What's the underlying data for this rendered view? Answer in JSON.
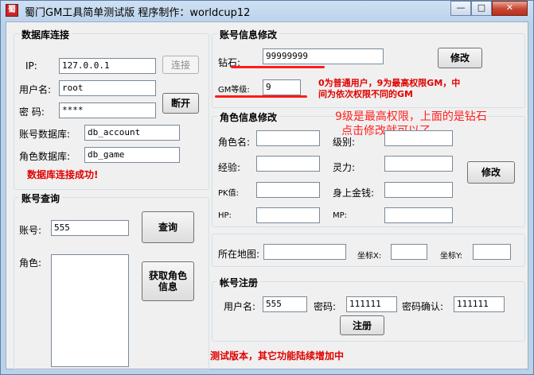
{
  "window": {
    "title": "蜀门GM工具简单测试版 程序制作：worldcup12",
    "minimize_glyph": "—",
    "maximize_glyph": "□",
    "close_glyph": "✕"
  },
  "db_section": {
    "title": "数据库连接",
    "ip_label": "IP:",
    "ip_value": "127.0.0.1",
    "user_label": "用户名:",
    "user_value": "root",
    "password_label": "密  码:",
    "password_value": "****",
    "account_db_label": "账号数据库:",
    "account_db_value": "db_account",
    "role_db_label": "角色数据库:",
    "role_db_value": "db_game",
    "connect_label": "连接",
    "disconnect_label": "断开",
    "status": "数据库连接成功!"
  },
  "account_query": {
    "title": "账号查询",
    "account_label": "账号:",
    "account_value": "555",
    "roles_label": "角色:",
    "query_label": "查询",
    "get_role_label": "获取角色\n信息"
  },
  "account_edit": {
    "title": "账号信息修改",
    "diamond_label": "钻石:",
    "diamond_value": "99999999",
    "gm_level_label": "GM等级:",
    "gm_level_value": "9",
    "modify_label": "修改",
    "note_line1": "0为普通用户，9为最高权限GM，中",
    "note_line2": "间为依次权限不同的GM"
  },
  "annotation": {
    "line1": "9级是最高权限，上面的是钻石",
    "line2": "点击修改就可以了",
    "color": "#ff2020"
  },
  "role_edit": {
    "title": "角色信息修改",
    "name_label": "角色名:",
    "level_label": "级别:",
    "exp_label": "经验:",
    "spirit_label": "灵力:",
    "pk_label": "PK值:",
    "money_label": "身上金钱:",
    "hp_label": "HP:",
    "mp_label": "MP:",
    "modify_label": "修改"
  },
  "location": {
    "map_label": "所在地图:",
    "x_label": "坐标X:",
    "y_label": "坐标Y:"
  },
  "register": {
    "title": "帐号注册",
    "user_label": "用户名:",
    "user_value": "555",
    "password_label": "密码:",
    "password_value": "111111",
    "confirm_label": "密码确认:",
    "confirm_value": "111111",
    "submit_label": "注册"
  },
  "footer": {
    "note": "测试版本，其它功能陆续增加中"
  },
  "colors": {
    "status_red": "#e00000",
    "mark_red": "#ff1a1a"
  }
}
